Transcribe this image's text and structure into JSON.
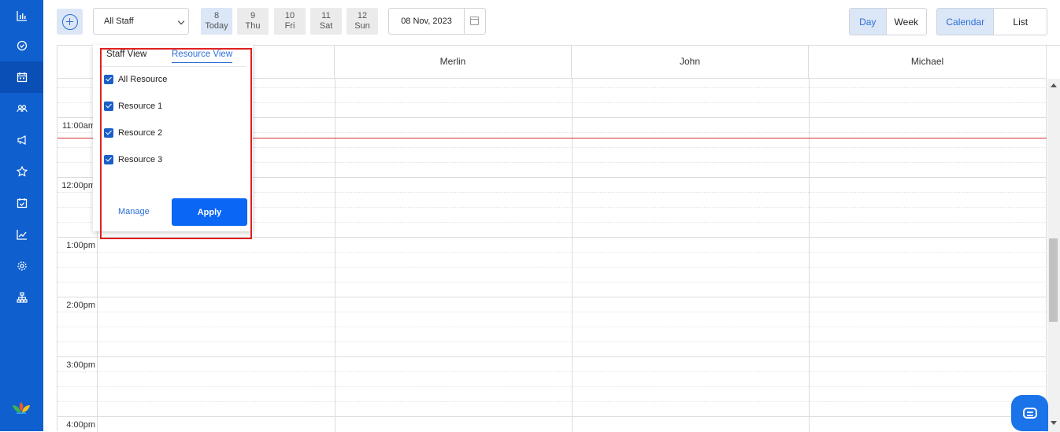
{
  "sidebar": {
    "icons": [
      "dashboard-icon",
      "check-circle-icon",
      "calendar-icon",
      "people-icon",
      "megaphone-icon",
      "star-icon",
      "calendar-check-icon",
      "trend-chart-icon",
      "gear-icon",
      "org-chart-icon"
    ],
    "active_index": 2
  },
  "toolbar": {
    "staff_select_value": "All Staff",
    "days": [
      {
        "num": "8",
        "label": "Today"
      },
      {
        "num": "9",
        "label": "Thu"
      },
      {
        "num": "10",
        "label": "Fri"
      },
      {
        "num": "11",
        "label": "Sat"
      },
      {
        "num": "12",
        "label": "Sun"
      }
    ],
    "date_value": "08 Nov, 2023",
    "view_modes": [
      "Day",
      "Week"
    ],
    "display_modes": [
      "Calendar",
      "List"
    ]
  },
  "calendar": {
    "columns": [
      "Merlin",
      "John",
      "Michael"
    ],
    "time_labels": [
      "11:00am",
      "12:00pm",
      "1:00pm",
      "2:00pm",
      "3:00pm",
      "4:00pm"
    ]
  },
  "popup": {
    "tabs": [
      "Staff View",
      "Resource View"
    ],
    "active_tab": "Resource View",
    "options": [
      "All Resource",
      "Resource 1",
      "Resource 2",
      "Resource 3"
    ],
    "manage_label": "Manage",
    "apply_label": "Apply"
  },
  "colors": {
    "sidebar": "#0f5fcf",
    "accent": "#2d6fd8",
    "apply_button": "#0a66f5",
    "current_time_line": "#dd3333",
    "highlight_border": "#e02020"
  }
}
